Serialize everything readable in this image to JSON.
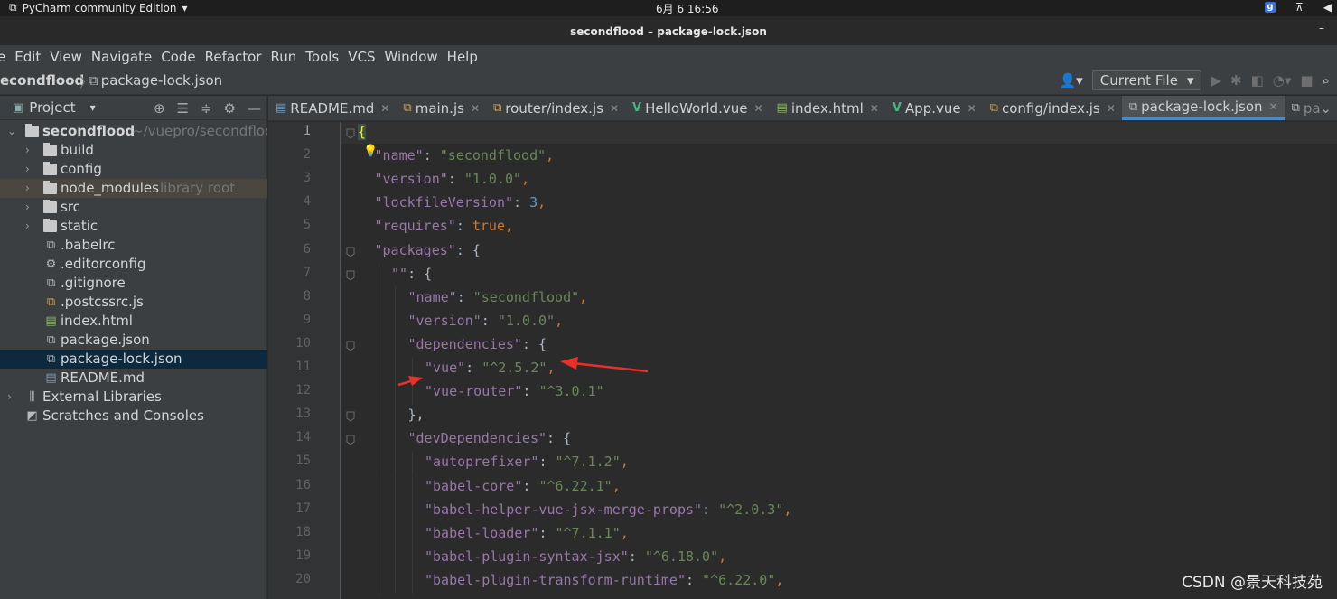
{
  "os": {
    "app_name": "PyCharm community Edition",
    "clock": "6月 6  16:56",
    "badge": "g"
  },
  "window": {
    "title": "secondflood – package-lock.json",
    "minimize": "–"
  },
  "menu": [
    "e",
    "Edit",
    "View",
    "Navigate",
    "Code",
    "Refactor",
    "Run",
    "Tools",
    "VCS",
    "Window",
    "Help"
  ],
  "nav": {
    "crumb_project": "econdflood",
    "crumb_file": "package-lock.json",
    "run_config": "Current File"
  },
  "project_panel": {
    "title": "Project",
    "tree": [
      {
        "label": "secondflood",
        "hint": "~/vuepro/secondfloo",
        "type": "root",
        "arrow": "⌄"
      },
      {
        "label": "build",
        "type": "folder",
        "arrow": "›"
      },
      {
        "label": "config",
        "type": "folder",
        "arrow": "›"
      },
      {
        "label": "node_modules",
        "hint": "library root",
        "type": "folder",
        "arrow": "›"
      },
      {
        "label": "src",
        "type": "folder",
        "arrow": "›"
      },
      {
        "label": "static",
        "type": "folder",
        "arrow": "›"
      },
      {
        "label": ".babelrc",
        "type": "file"
      },
      {
        "label": ".editorconfig",
        "type": "gear-file"
      },
      {
        "label": ".gitignore",
        "type": "file"
      },
      {
        "label": ".postcssrc.js",
        "type": "js-file"
      },
      {
        "label": "index.html",
        "type": "html-file"
      },
      {
        "label": "package.json",
        "type": "file"
      },
      {
        "label": "package-lock.json",
        "type": "file",
        "selected": true
      },
      {
        "label": "README.md",
        "type": "md-file"
      },
      {
        "label": "External Libraries",
        "type": "libraries",
        "arrow": "›"
      },
      {
        "label": "Scratches and Consoles",
        "type": "scratches"
      }
    ]
  },
  "tabs": [
    {
      "label": "README.md",
      "icon": "md"
    },
    {
      "label": "main.js",
      "icon": "js"
    },
    {
      "label": "router/index.js",
      "icon": "js"
    },
    {
      "label": "HelloWorld.vue",
      "icon": "vue"
    },
    {
      "label": "index.html",
      "icon": "html"
    },
    {
      "label": "App.vue",
      "icon": "vue"
    },
    {
      "label": "config/index.js",
      "icon": "js"
    },
    {
      "label": "package-lock.json",
      "icon": "json",
      "active": true
    },
    {
      "label": "pa",
      "icon": "json"
    }
  ],
  "editor": {
    "current_line": 1,
    "lines": [
      {
        "n": "1",
        "indent": 0,
        "tokens": [
          {
            "t": "{",
            "c": "brace-hl"
          }
        ]
      },
      {
        "n": "2",
        "indent": 1,
        "tokens": [
          {
            "t": "\"name\"",
            "c": "k"
          },
          {
            "t": ": ",
            "c": ""
          },
          {
            "t": "\"secondflood\"",
            "c": "s"
          },
          {
            "t": ",",
            "c": "p"
          }
        ]
      },
      {
        "n": "3",
        "indent": 1,
        "tokens": [
          {
            "t": "\"version\"",
            "c": "k"
          },
          {
            "t": ": ",
            "c": ""
          },
          {
            "t": "\"1.0.0\"",
            "c": "s"
          },
          {
            "t": ",",
            "c": "p"
          }
        ]
      },
      {
        "n": "4",
        "indent": 1,
        "tokens": [
          {
            "t": "\"lockfileVersion\"",
            "c": "k"
          },
          {
            "t": ": ",
            "c": ""
          },
          {
            "t": "3",
            "c": "n"
          },
          {
            "t": ",",
            "c": "p"
          }
        ]
      },
      {
        "n": "5",
        "indent": 1,
        "tokens": [
          {
            "t": "\"requires\"",
            "c": "k"
          },
          {
            "t": ": ",
            "c": ""
          },
          {
            "t": "true",
            "c": "b"
          },
          {
            "t": ",",
            "c": "p"
          }
        ]
      },
      {
        "n": "6",
        "indent": 1,
        "tokens": [
          {
            "t": "\"packages\"",
            "c": "k"
          },
          {
            "t": ": {",
            "c": ""
          }
        ]
      },
      {
        "n": "7",
        "indent": 2,
        "tokens": [
          {
            "t": "\"\"",
            "c": "k"
          },
          {
            "t": ": {",
            "c": ""
          }
        ]
      },
      {
        "n": "8",
        "indent": 3,
        "tokens": [
          {
            "t": "\"name\"",
            "c": "k"
          },
          {
            "t": ": ",
            "c": ""
          },
          {
            "t": "\"secondflood\"",
            "c": "s"
          },
          {
            "t": ",",
            "c": "p"
          }
        ]
      },
      {
        "n": "9",
        "indent": 3,
        "tokens": [
          {
            "t": "\"version\"",
            "c": "k"
          },
          {
            "t": ": ",
            "c": ""
          },
          {
            "t": "\"1.0.0\"",
            "c": "s"
          },
          {
            "t": ",",
            "c": "p"
          }
        ]
      },
      {
        "n": "10",
        "indent": 3,
        "tokens": [
          {
            "t": "\"dependencies\"",
            "c": "k"
          },
          {
            "t": ": {",
            "c": ""
          }
        ]
      },
      {
        "n": "11",
        "indent": 4,
        "tokens": [
          {
            "t": "\"vue\"",
            "c": "k"
          },
          {
            "t": ": ",
            "c": ""
          },
          {
            "t": "\"^2.5.2\"",
            "c": "s"
          },
          {
            "t": ",",
            "c": "p"
          }
        ]
      },
      {
        "n": "12",
        "indent": 4,
        "tokens": [
          {
            "t": "\"vue-router\"",
            "c": "k"
          },
          {
            "t": ": ",
            "c": ""
          },
          {
            "t": "\"^3.0.1\"",
            "c": "s"
          }
        ]
      },
      {
        "n": "13",
        "indent": 3,
        "tokens": [
          {
            "t": "},",
            "c": ""
          }
        ]
      },
      {
        "n": "14",
        "indent": 3,
        "tokens": [
          {
            "t": "\"devDependencies\"",
            "c": "k"
          },
          {
            "t": ": {",
            "c": ""
          }
        ]
      },
      {
        "n": "15",
        "indent": 4,
        "tokens": [
          {
            "t": "\"autoprefixer\"",
            "c": "k"
          },
          {
            "t": ": ",
            "c": ""
          },
          {
            "t": "\"^7.1.2\"",
            "c": "s"
          },
          {
            "t": ",",
            "c": "p"
          }
        ]
      },
      {
        "n": "16",
        "indent": 4,
        "tokens": [
          {
            "t": "\"babel-core\"",
            "c": "k"
          },
          {
            "t": ": ",
            "c": ""
          },
          {
            "t": "\"^6.22.1\"",
            "c": "s"
          },
          {
            "t": ",",
            "c": "p"
          }
        ]
      },
      {
        "n": "17",
        "indent": 4,
        "tokens": [
          {
            "t": "\"babel-helper-vue-jsx-merge-props\"",
            "c": "k"
          },
          {
            "t": ": ",
            "c": ""
          },
          {
            "t": "\"^2.0.3\"",
            "c": "s"
          },
          {
            "t": ",",
            "c": "p"
          }
        ]
      },
      {
        "n": "18",
        "indent": 4,
        "tokens": [
          {
            "t": "\"babel-loader\"",
            "c": "k"
          },
          {
            "t": ": ",
            "c": ""
          },
          {
            "t": "\"^7.1.1\"",
            "c": "s"
          },
          {
            "t": ",",
            "c": "p"
          }
        ]
      },
      {
        "n": "19",
        "indent": 4,
        "tokens": [
          {
            "t": "\"babel-plugin-syntax-jsx\"",
            "c": "k"
          },
          {
            "t": ": ",
            "c": ""
          },
          {
            "t": "\"^6.18.0\"",
            "c": "s"
          },
          {
            "t": ",",
            "c": "p"
          }
        ]
      },
      {
        "n": "20",
        "indent": 4,
        "tokens": [
          {
            "t": "\"babel-plugin-transform-runtime\"",
            "c": "k"
          },
          {
            "t": ": ",
            "c": ""
          },
          {
            "t": "\"^6.22.0\"",
            "c": "s"
          },
          {
            "t": ",",
            "c": "p"
          }
        ]
      }
    ],
    "fold_lines": [
      1,
      6,
      7,
      10,
      13,
      14
    ]
  },
  "watermark": "CSDN @景天科技苑",
  "colors": {
    "annotation_arrow": "#e8302a",
    "selection": "#0d293e",
    "tab_underline": "#4a88c7"
  }
}
